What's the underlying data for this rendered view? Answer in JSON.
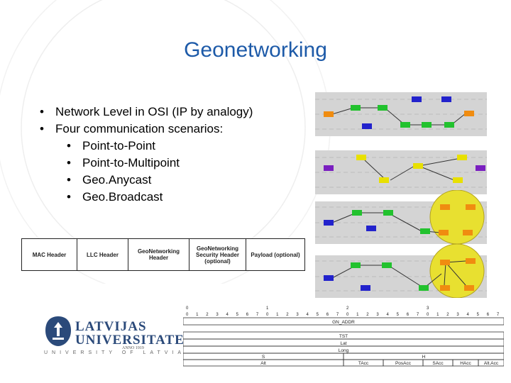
{
  "slide": {
    "title": "Geonetworking",
    "bullets": [
      {
        "text": "Network Level in OSI (IP by analogy)",
        "level": 1
      },
      {
        "text": "Four communication scenarios:",
        "level": 1
      },
      {
        "text": "Point-to-Point",
        "level": 2
      },
      {
        "text": "Point-to-Multipoint",
        "level": 2
      },
      {
        "text": "Geo.Anycast",
        "level": 2
      },
      {
        "text": "Geo.Broadcast",
        "level": 2
      }
    ],
    "bullet_char": "•"
  },
  "header_diagram": {
    "cells": [
      "MAC Header",
      "LLC Header",
      "GeoNetworking Header",
      "GeoNetworking Security Header (optional)",
      "Payload (optional)"
    ]
  },
  "logo": {
    "line1": "LATVIJAS",
    "line2": "UNIVERSITATE",
    "anno": "ANNO 1919",
    "english": "UNIVERSITY OF LATVIA",
    "color": "#2b4a7a"
  },
  "packet_format": {
    "byte_labels": [
      "0",
      "1",
      "2",
      "3"
    ],
    "bit_labels": [
      "0",
      "1",
      "2",
      "3",
      "4",
      "5",
      "6",
      "7",
      "0",
      "1",
      "2",
      "3",
      "4",
      "5",
      "6",
      "7",
      "0",
      "1",
      "2",
      "3",
      "4",
      "5",
      "6",
      "7",
      "0",
      "1",
      "2",
      "3",
      "4",
      "5",
      "6",
      "7"
    ],
    "fields": {
      "gn_addr": "GN_ADDR",
      "tst": "TST",
      "lat": "Lat",
      "long": "Long",
      "s": "S",
      "h": "H",
      "alt": "Alt",
      "tacc": "TAcc",
      "posacc": "PosAcc",
      "sacc": "SAcc",
      "hacc": "HAcc",
      "altacc": "Alt.Acc"
    }
  },
  "colors": {
    "title": "#1d5aa8",
    "node_green": "#22c22e",
    "node_blue": "#2222cc",
    "node_yellow": "#e8e000",
    "node_orange": "#f08c10",
    "node_purple": "#7a1fc0",
    "highlight": "#e8e030"
  }
}
